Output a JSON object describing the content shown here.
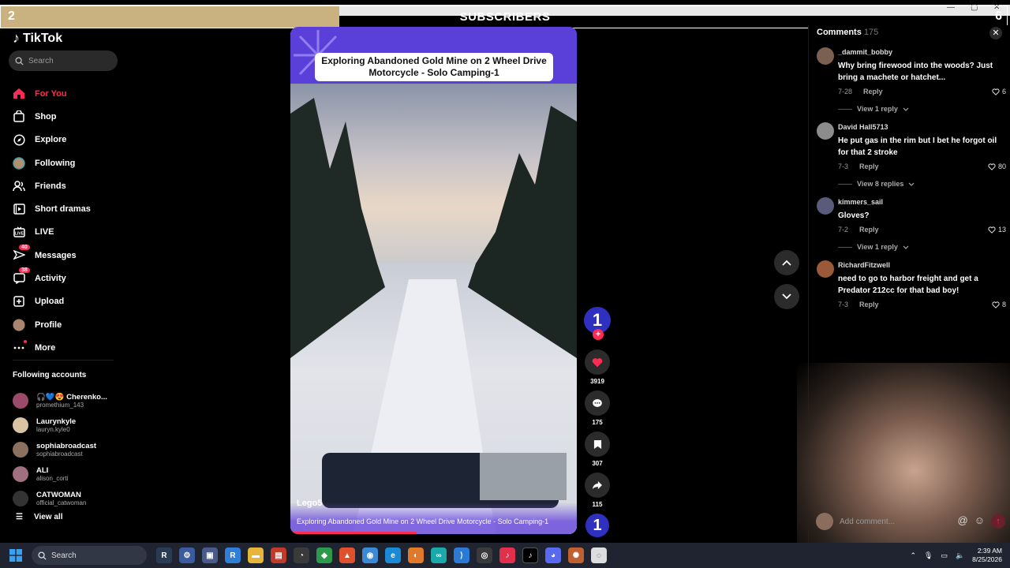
{
  "overlay": {
    "left_value": "2",
    "title": "SUBSCRIBERS",
    "right_value": "6"
  },
  "window": {
    "minimize": "—",
    "maximize": "▢",
    "close": "✕"
  },
  "sidebar": {
    "logo": "TikTok",
    "search_placeholder": "Search",
    "nav": [
      {
        "label": "For You",
        "icon": "home-icon",
        "active": true
      },
      {
        "label": "Shop",
        "icon": "shopping-bag-icon"
      },
      {
        "label": "Explore",
        "icon": "compass-icon"
      },
      {
        "label": "Following",
        "icon": "following-avatar-icon"
      },
      {
        "label": "Friends",
        "icon": "friends-icon"
      },
      {
        "label": "Short dramas",
        "icon": "short-dramas-icon"
      },
      {
        "label": "LIVE",
        "icon": "live-icon"
      },
      {
        "label": "Messages",
        "icon": "messages-icon",
        "badge": "40"
      },
      {
        "label": "Activity",
        "icon": "activity-icon",
        "badge": "38"
      },
      {
        "label": "Upload",
        "icon": "upload-icon"
      },
      {
        "label": "Profile",
        "icon": "profile-avatar-icon"
      },
      {
        "label": "More",
        "icon": "more-icon"
      }
    ],
    "following_heading": "Following accounts",
    "following": [
      {
        "name": "🎧💙😍 Cherenko...",
        "handle": "promethium_143",
        "color": "#9b4a6a"
      },
      {
        "name": "Laurynkyle",
        "handle": "lauryn.kyle0",
        "color": "#d9c3a5"
      },
      {
        "name": "sophiabroadcast",
        "handle": "sophiabroadcast",
        "color": "#8a7060"
      },
      {
        "name": "ALI",
        "handle": "alison_corti",
        "color": "#a07080"
      },
      {
        "name": "CATWOMAN",
        "handle": "official_catwoman",
        "color": "#333333"
      }
    ],
    "view_all": "View all"
  },
  "video": {
    "title": "Exploring Abandoned Gold Mine on 2 Wheel Drive Motorcycle - Solo Camping-1",
    "author": "Lego5",
    "caption": "Exploring Abandoned Gold Mine on 2 Wheel Drive Motorcycle - Solo Camping-1",
    "progress": 0.44
  },
  "actions": {
    "creator_initial": "1",
    "likes": "3919",
    "comments": "175",
    "saves": "307",
    "shares": "115",
    "sound_initial": "1"
  },
  "comments": {
    "title": "Comments",
    "count": "175",
    "items": [
      {
        "user": "_dammit_bobby",
        "text": "Why bring firewood into the woods? Just bring a machete or hatchet...",
        "date": "7-28",
        "likes": "6",
        "replies": "View 1 reply",
        "color": "#7a6050"
      },
      {
        "user": "David Hall5713",
        "text": "He put gas in the rim but I bet he forgot oil for that 2 stroke",
        "date": "7-3",
        "likes": "80",
        "replies": "View 8 replies",
        "color": "#8c8c8c"
      },
      {
        "user": "kimmers_sail",
        "text": "Gloves?",
        "date": "7-2",
        "likes": "13",
        "replies": "View 1 reply",
        "color": "#5a5a7a"
      },
      {
        "user": "RichardFitzwell",
        "text": "need to go to harbor freight and get a Predator 212cc for that bad boy!",
        "date": "7-3",
        "likes": "8",
        "replies": "",
        "color": "#9a5a3a"
      }
    ],
    "reply_label": "Reply",
    "input_placeholder": "Add comment..."
  },
  "taskbar": {
    "search": "Search",
    "time": "2:39 AM",
    "date": "8/25/2026"
  },
  "colors": {
    "accent": "#fe2c55",
    "banner": "#5b3fd9",
    "background": "#000000"
  }
}
